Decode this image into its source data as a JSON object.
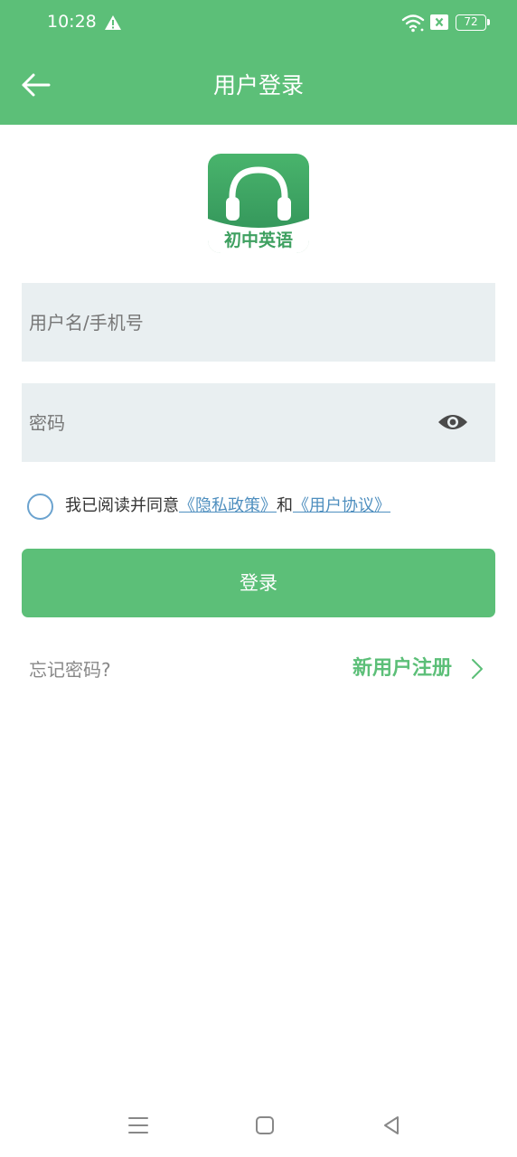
{
  "status_bar": {
    "time": "10:28",
    "battery": "72",
    "icons": [
      "warning-icon",
      "wifi-icon",
      "sim-x-icon",
      "battery-icon"
    ]
  },
  "header": {
    "title": "用户登录",
    "back_icon": "arrow-left-icon"
  },
  "logo": {
    "text": "初中英语",
    "icon": "headphones-icon"
  },
  "form": {
    "username_placeholder": "用户名/手机号",
    "username_value": "",
    "password_placeholder": "密码",
    "password_value": "",
    "eye_icon": "eye-icon"
  },
  "agreement": {
    "prefix": "我已阅读并同意",
    "privacy_link": "《隐私政策》",
    "conjunction": "和",
    "terms_link": "《用户协议》",
    "checked": false
  },
  "actions": {
    "login_label": "登录",
    "forgot_label": "忘记密码?",
    "register_label": "新用户注册"
  },
  "colors": {
    "brand": "#5cbf78",
    "field_bg": "#e9eff1",
    "link": "#4f8fbf"
  }
}
